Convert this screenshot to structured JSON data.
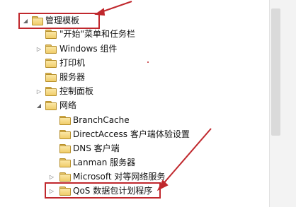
{
  "tree": {
    "items": [
      {
        "label": "管理模板",
        "expander": "◢",
        "highlighted": true
      },
      {
        "label": "\"开始\"菜单和任务栏",
        "expander": ""
      },
      {
        "label": "Windows 组件",
        "expander": "▷"
      },
      {
        "label": "打印机",
        "expander": ""
      },
      {
        "label": "服务器",
        "expander": ""
      },
      {
        "label": "控制面板",
        "expander": "▷"
      },
      {
        "label": "网络",
        "expander": "◢"
      },
      {
        "label": "BranchCache",
        "expander": ""
      },
      {
        "label": "DirectAccess 客户端体验设置",
        "expander": ""
      },
      {
        "label": "DNS 客户端",
        "expander": ""
      },
      {
        "label": "Lanman 服务器",
        "expander": ""
      },
      {
        "label": "Microsoft 对等网络服务",
        "expander": "▷"
      },
      {
        "label": "QoS 数据包计划程序",
        "expander": "▷",
        "highlighted": true
      }
    ]
  },
  "colors": {
    "highlight_border": "#c0282d",
    "folder_fill": "#f0cd6a",
    "folder_border": "#b78f2a"
  }
}
